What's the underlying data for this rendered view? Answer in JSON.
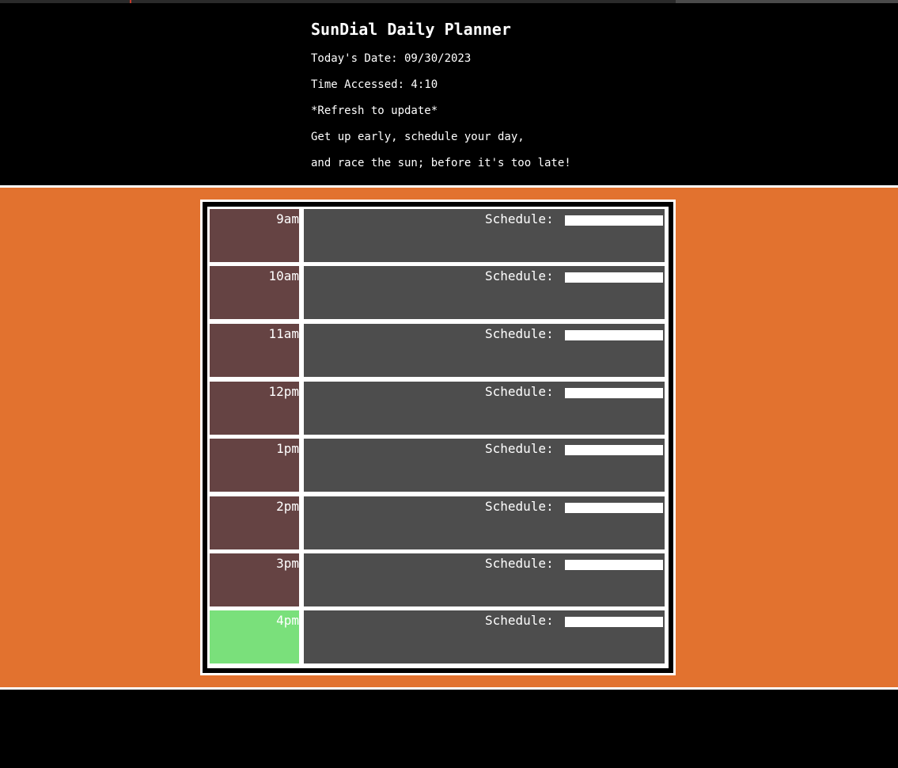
{
  "header": {
    "title": "SunDial Daily Planner",
    "date_line": "Today's Date: 09/30/2023",
    "time_line": "Time Accessed: 4:10",
    "refresh_note": "*Refresh to update*",
    "tagline_1": "Get up early, schedule your day,",
    "tagline_2": "and race the sun; before it's too late!"
  },
  "colors": {
    "page_background": "#000000",
    "planner_area": "#e2722f",
    "past_hour": "#654343",
    "present_hour": "#7ae07b",
    "schedule_slot": "#4d4d4d"
  },
  "planner": {
    "rows": [
      {
        "hour": "9am",
        "schedule_label": "Schedule:",
        "value": "",
        "state": "past"
      },
      {
        "hour": "10am",
        "schedule_label": "Schedule:",
        "value": "",
        "state": "past"
      },
      {
        "hour": "11am",
        "schedule_label": "Schedule:",
        "value": "",
        "state": "past"
      },
      {
        "hour": "12pm",
        "schedule_label": "Schedule:",
        "value": "",
        "state": "past"
      },
      {
        "hour": "1pm",
        "schedule_label": "Schedule:",
        "value": "",
        "state": "past"
      },
      {
        "hour": "2pm",
        "schedule_label": "Schedule:",
        "value": "",
        "state": "past"
      },
      {
        "hour": "3pm",
        "schedule_label": "Schedule:",
        "value": "",
        "state": "past"
      },
      {
        "hour": "4pm",
        "schedule_label": "Schedule:",
        "value": "",
        "state": "present"
      }
    ]
  }
}
